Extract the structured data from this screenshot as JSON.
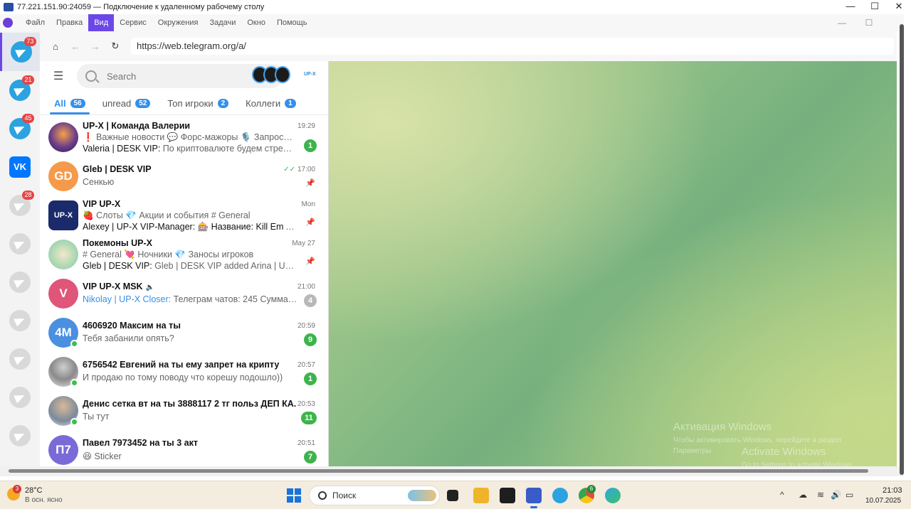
{
  "window": {
    "title": "77.221.151.90:24059 — Подключение к удаленному рабочему столу",
    "minimize": "—",
    "maximize": "☐",
    "close": "✕"
  },
  "menubar": {
    "items": [
      "Файл",
      "Правка",
      "Вид",
      "Сервис",
      "Окружения",
      "Задачи",
      "Окно",
      "Помощь"
    ],
    "active_index": 2,
    "right_buttons": [
      "—",
      "☐"
    ]
  },
  "rail": {
    "items": [
      {
        "icon": "telegram-icon",
        "badge": "73"
      },
      {
        "icon": "telegram-icon",
        "badge": "21"
      },
      {
        "icon": "telegram-icon",
        "badge": "45"
      },
      {
        "icon": "vk-icon",
        "label": "VK"
      },
      {
        "icon": "telegram-icon",
        "badge": "28"
      }
    ]
  },
  "browser": {
    "url": "https://web.telegram.org/a/",
    "home": "⌂",
    "back": "←",
    "forward": "→",
    "reload": "↻"
  },
  "telegram": {
    "search_placeholder": "Search",
    "logo_text": "UP-X",
    "folders": [
      {
        "label": "All",
        "count": "56"
      },
      {
        "label": "unread",
        "count": "52"
      },
      {
        "label": "Топ игроки",
        "count": "2"
      },
      {
        "label": "Коллеги",
        "count": "1"
      }
    ],
    "chats": [
      {
        "title": "UP-X | Команда Валерии",
        "time": "19:29",
        "line1": "❗ Важные новости 💬 Форс-мажоры 🎙️ Запросы на...",
        "sender": "Valeria | DESK VIP: ",
        "line2": "По криптовалюте будем стреми...",
        "badge": "1"
      },
      {
        "title": "Gleb | DESK VIP",
        "time": "17:00",
        "check": "✓✓",
        "line1": "Сенкью",
        "pin": "📌",
        "initials": "GD"
      },
      {
        "title": "VIP UP-X",
        "time": "Mon",
        "line1": "🍓 Слоты 💎 Акции и события # General",
        "sender": "Alexey | UP-X VIP-Manager: ",
        "line2": "🎰 Название: Kill Em All ...",
        "pin": "📌",
        "avatar_text": "UP-X"
      },
      {
        "title": "Покемоны UP-X",
        "time": "May 27",
        "line1": "# General 💘 Ночники 💎 Заносы игроков",
        "sender": "Gleb | DESK VIP: ",
        "line2": "Gleb | DESK VIP added Arina | UP-X C...",
        "pin": "📌"
      },
      {
        "title": "VIP UP-X MSK",
        "time": "21:00",
        "mute": "🔈",
        "sender": "Nikolay | UP-X Closer: ",
        "line1": "Телеграм чатов: 245 Суммарно...",
        "badge": "4",
        "initials": "V"
      },
      {
        "title": "4606920 Максим на ты",
        "time": "20:59",
        "line1": "Тебя забанили опять?",
        "badge": "9",
        "initials": "4M"
      },
      {
        "title": "6756542 Евгений на ты ему запрет на крипту",
        "time": "20:57",
        "line1": "И продаю по тому поводу что корешу подошло))",
        "badge": "1"
      },
      {
        "title": "Денис сетка вт на ты 3888117 2 тг польз ДЕП КА...",
        "time": "20:53",
        "line1": "Ты тут",
        "badge": "11"
      },
      {
        "title": "Павел 7973452 на ты 3 акт",
        "time": "20:51",
        "line1": "😆 Sticker",
        "badge": "7",
        "initials": "П7"
      }
    ]
  },
  "watermark": {
    "ru_title": "Активация Windows",
    "ru_sub": "Чтобы активировать Windows, перейдите в раздел",
    "ru_sub2": "Параметры",
    "en_title": "Activate Windows",
    "en_sub": "Go to Settings to activate Windows."
  },
  "taskbar": {
    "weather_badge": "3",
    "temperature": "28°C",
    "weather_desc": "В осн. ясно",
    "search_label": "Поиск",
    "chrome_badge": "6",
    "time": "21:03",
    "date": "10.07.2025",
    "tray_up": "^"
  },
  "colors": {
    "accent": "#3390ec",
    "menu_active": "#6c47e8",
    "unread_green": "#3cb44b",
    "rail_badge": "#e64545"
  }
}
